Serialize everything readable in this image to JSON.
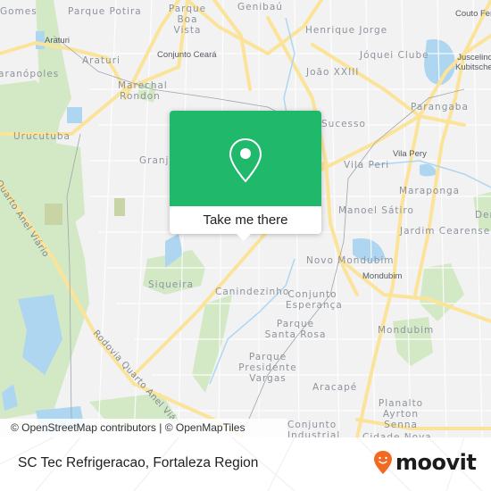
{
  "map": {
    "neighborhoods": [
      {
        "name": "Gomes"
      },
      {
        "name": "Parque Potira"
      },
      {
        "name": "Parque Boa Vista"
      },
      {
        "name": "Genibaú"
      },
      {
        "name": "Henrique Jorge"
      },
      {
        "name": "Couto Fernandes"
      },
      {
        "name": "Araturi"
      },
      {
        "name": "Jóquei Clube"
      },
      {
        "name": "Juscelino Kubitschek"
      },
      {
        "name": "Maranópoles"
      },
      {
        "name": "Marechal Rondon"
      },
      {
        "name": "João XXIII"
      },
      {
        "name": "Parangaba"
      },
      {
        "name": "Urucutuba"
      },
      {
        "name": "Granja"
      },
      {
        "name": "Sucesso"
      },
      {
        "name": "Vila Peri"
      },
      {
        "name": "Maraponga"
      },
      {
        "name": "Manoel Sátiro"
      },
      {
        "name": "Jardim Cearense"
      },
      {
        "name": "Dendê"
      },
      {
        "name": "Novo Mondubim"
      },
      {
        "name": "Siqueira"
      },
      {
        "name": "Canindezinho"
      },
      {
        "name": "Conjunto Esperança"
      },
      {
        "name": "Parque Santa Rosa"
      },
      {
        "name": "Mondubim"
      },
      {
        "name": "Parque Presidente Vargas"
      },
      {
        "name": "Aracapé"
      },
      {
        "name": "Planalto Ayrton Senna"
      },
      {
        "name": "Conjunto Industrial"
      },
      {
        "name": "Cidade Nova"
      }
    ],
    "stations": [
      {
        "name": "Araturi"
      },
      {
        "name": "Conjunto Ceará"
      },
      {
        "name": "Vila Pery"
      },
      {
        "name": "Mondubim"
      },
      {
        "name": "Juscelino Kubitschek"
      }
    ],
    "roads": [
      {
        "name": "Rodovia Quarto Anel Viário"
      },
      {
        "name": "Quarto Anel Viário"
      }
    ],
    "attribution": "© OpenStreetMap contributors | © OpenMapTiles"
  },
  "popup": {
    "icon": "map-pin-icon",
    "button_label": "Take me there",
    "color": "#20b86a"
  },
  "footer": {
    "place_title": "SC Tec Refrigeracao, Fortaleza Region",
    "logo_text": "moovit",
    "logo_color": "#f26a21"
  }
}
